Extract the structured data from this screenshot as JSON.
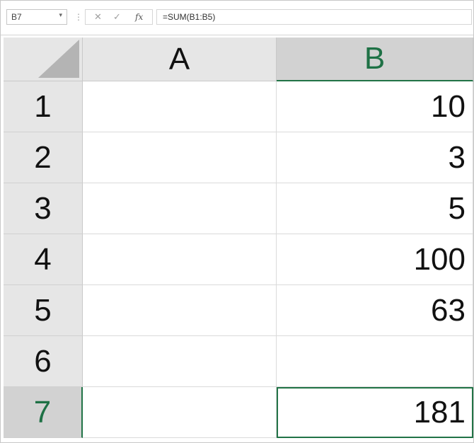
{
  "name_box": {
    "value": "B7",
    "dropdown_glyph": "▾"
  },
  "separator": "⋮",
  "formula_buttons": {
    "cancel": "✕",
    "enter": "✓",
    "fx": "fx"
  },
  "formula": {
    "value": "=SUM(B1:B5)"
  },
  "columns": [
    "A",
    "B"
  ],
  "active_cell": "B7",
  "rows": [
    {
      "number": "1",
      "a": "",
      "b": "10"
    },
    {
      "number": "2",
      "a": "",
      "b": "3"
    },
    {
      "number": "3",
      "a": "",
      "b": "5"
    },
    {
      "number": "4",
      "a": "",
      "b": "100"
    },
    {
      "number": "5",
      "a": "",
      "b": "63"
    },
    {
      "number": "6",
      "a": "",
      "b": ""
    },
    {
      "number": "7",
      "a": "",
      "b": "181"
    }
  ],
  "colors": {
    "accent": "#217346",
    "header_bg": "#e6e6e6",
    "selected_header_bg": "#d2d2d2"
  }
}
